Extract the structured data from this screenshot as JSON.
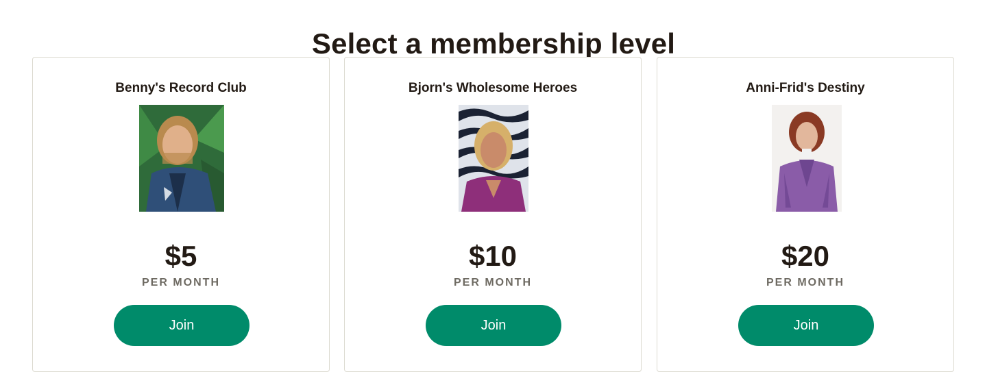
{
  "page": {
    "title": "Select a membership level"
  },
  "tiers": [
    {
      "name": "Benny's Record Club",
      "price": "$5",
      "period": "PER MONTH",
      "join_label": "Join"
    },
    {
      "name": "Bjorn's Wholesome Heroes",
      "price": "$10",
      "period": "PER MONTH",
      "join_label": "Join"
    },
    {
      "name": "Anni-Frid's Destiny",
      "price": "$20",
      "period": "PER MONTH",
      "join_label": "Join"
    }
  ],
  "colors": {
    "accent": "#008b6a",
    "text": "#221a14",
    "muted": "#6e6a62",
    "border": "#dcdad0"
  }
}
